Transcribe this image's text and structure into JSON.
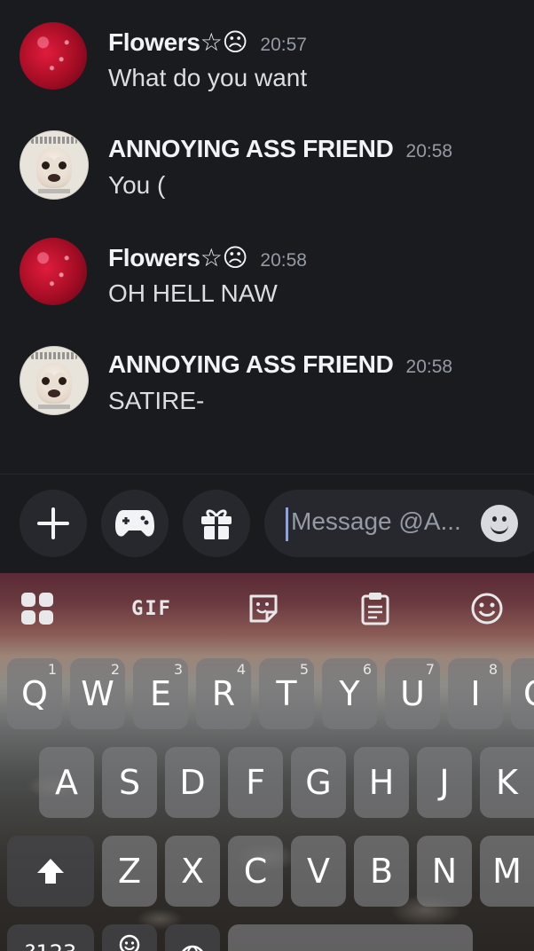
{
  "messages": [
    {
      "author": "Flowers☆☹",
      "time": "20:57",
      "text": "What do you want",
      "avatar": "flower-avatar"
    },
    {
      "author": "ANNOYING ASS FRIEND",
      "time": "20:58",
      "text": "You (",
      "avatar": "dog-avatar"
    },
    {
      "author": "Flowers☆☹",
      "time": "20:58",
      "text": "OH HELL NAW",
      "avatar": "flower-avatar"
    },
    {
      "author": "ANNOYING ASS FRIEND",
      "time": "20:58",
      "text": "SATIRE-",
      "avatar": "dog-avatar"
    }
  ],
  "composer": {
    "placeholder": "Message @A...",
    "buttons": [
      "plus-icon",
      "gamepad-icon",
      "gift-icon"
    ],
    "emoji_icon": "smiley-icon"
  },
  "keyboard": {
    "toolbar": {
      "grid_icon": "apps-grid-icon",
      "gif_label": "GIF",
      "sticker_icon": "sticker-icon",
      "clipboard_icon": "clipboard-icon",
      "emoji_icon": "emoji-icon"
    },
    "row1": [
      {
        "k": "Q",
        "n": "1"
      },
      {
        "k": "W",
        "n": "2"
      },
      {
        "k": "E",
        "n": "3"
      },
      {
        "k": "R",
        "n": "4"
      },
      {
        "k": "T",
        "n": "5"
      },
      {
        "k": "Y",
        "n": "6"
      },
      {
        "k": "U",
        "n": "7"
      },
      {
        "k": "I",
        "n": "8"
      },
      {
        "k": "O",
        "n": ""
      }
    ],
    "row2": [
      "A",
      "S",
      "D",
      "F",
      "G",
      "H",
      "J",
      "K"
    ],
    "row3": [
      "Z",
      "X",
      "C",
      "V",
      "B",
      "N",
      "M"
    ],
    "shift_icon": "shift-arrow-icon",
    "bottom_row": {
      "symbols": "?123",
      "emoji_icon": "emoji-icon",
      "globe_icon": "globe-icon"
    }
  },
  "colors": {
    "background": "#1a1b1f",
    "surface": "#26282d",
    "muted_text": "#949ba4",
    "caret": "#8ea1e1"
  }
}
